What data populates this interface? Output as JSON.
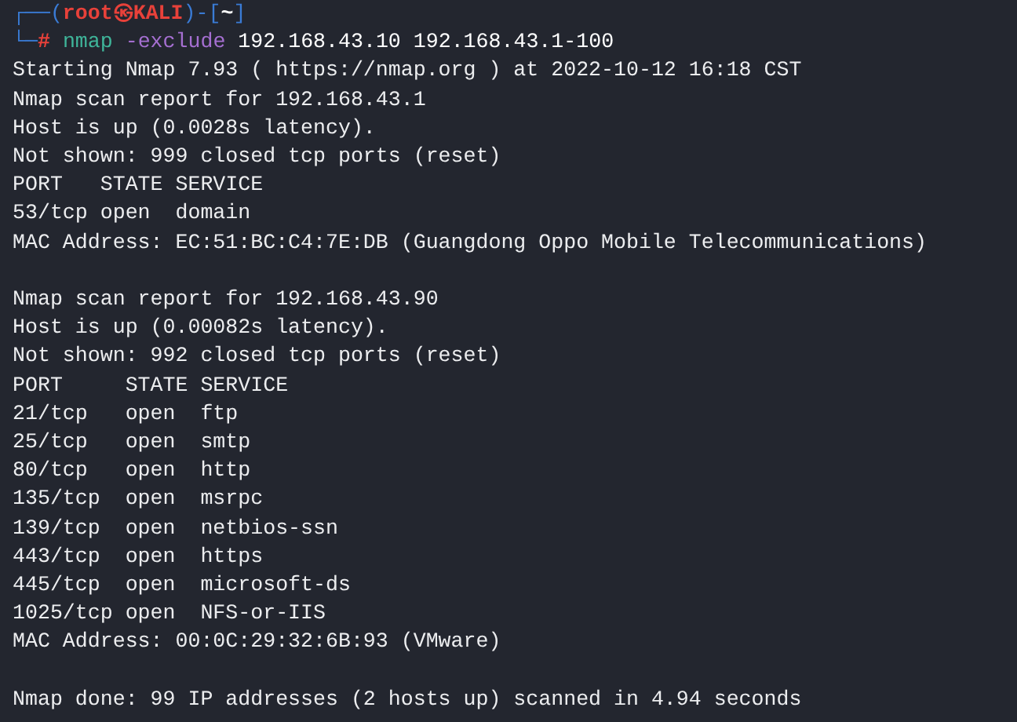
{
  "terminal": {
    "prompt": [
      {
        "kind": "frame",
        "text": "┌──("
      },
      {
        "kind": "user",
        "text": "root㉿KALI"
      },
      {
        "kind": "frame",
        "text": ")-["
      },
      {
        "kind": "path",
        "text": "~"
      },
      {
        "kind": "frame",
        "text": "]"
      }
    ],
    "command_line": [
      {
        "kind": "frame",
        "text": "└─"
      },
      {
        "kind": "symbol",
        "text": "#"
      },
      {
        "kind": "command",
        "text": "nmap"
      },
      {
        "kind": "option",
        "text": "-exclude"
      },
      {
        "kind": "argument",
        "text": "192.168.43.10 192.168.43.1-100"
      }
    ],
    "output_blocks": [
      [
        "Starting Nmap 7.93 ( https://nmap.org ) at 2022-10-12 16:18 CST",
        "Nmap scan report for 192.168.43.1",
        "Host is up (0.0028s latency).",
        "Not shown: 999 closed tcp ports (reset)",
        "PORT   STATE SERVICE",
        "53/tcp open  domain",
        "MAC Address: EC:51:BC:C4:7E:DB (Guangdong Oppo Mobile Telecommunications)"
      ],
      [
        "Nmap scan report for 192.168.43.90",
        "Host is up (0.00082s latency).",
        "Not shown: 992 closed tcp ports (reset)",
        "PORT     STATE SERVICE",
        "21/tcp   open  ftp",
        "25/tcp   open  smtp",
        "80/tcp   open  http",
        "135/tcp  open  msrpc",
        "139/tcp  open  netbios-ssn",
        "443/tcp  open  https",
        "445/tcp  open  microsoft-ds",
        "1025/tcp open  NFS-or-IIS",
        "MAC Address: 00:0C:29:32:6B:93 (VMware)"
      ],
      [
        "Nmap done: 99 IP addresses (2 hosts up) scanned in 4.94 seconds"
      ]
    ]
  }
}
